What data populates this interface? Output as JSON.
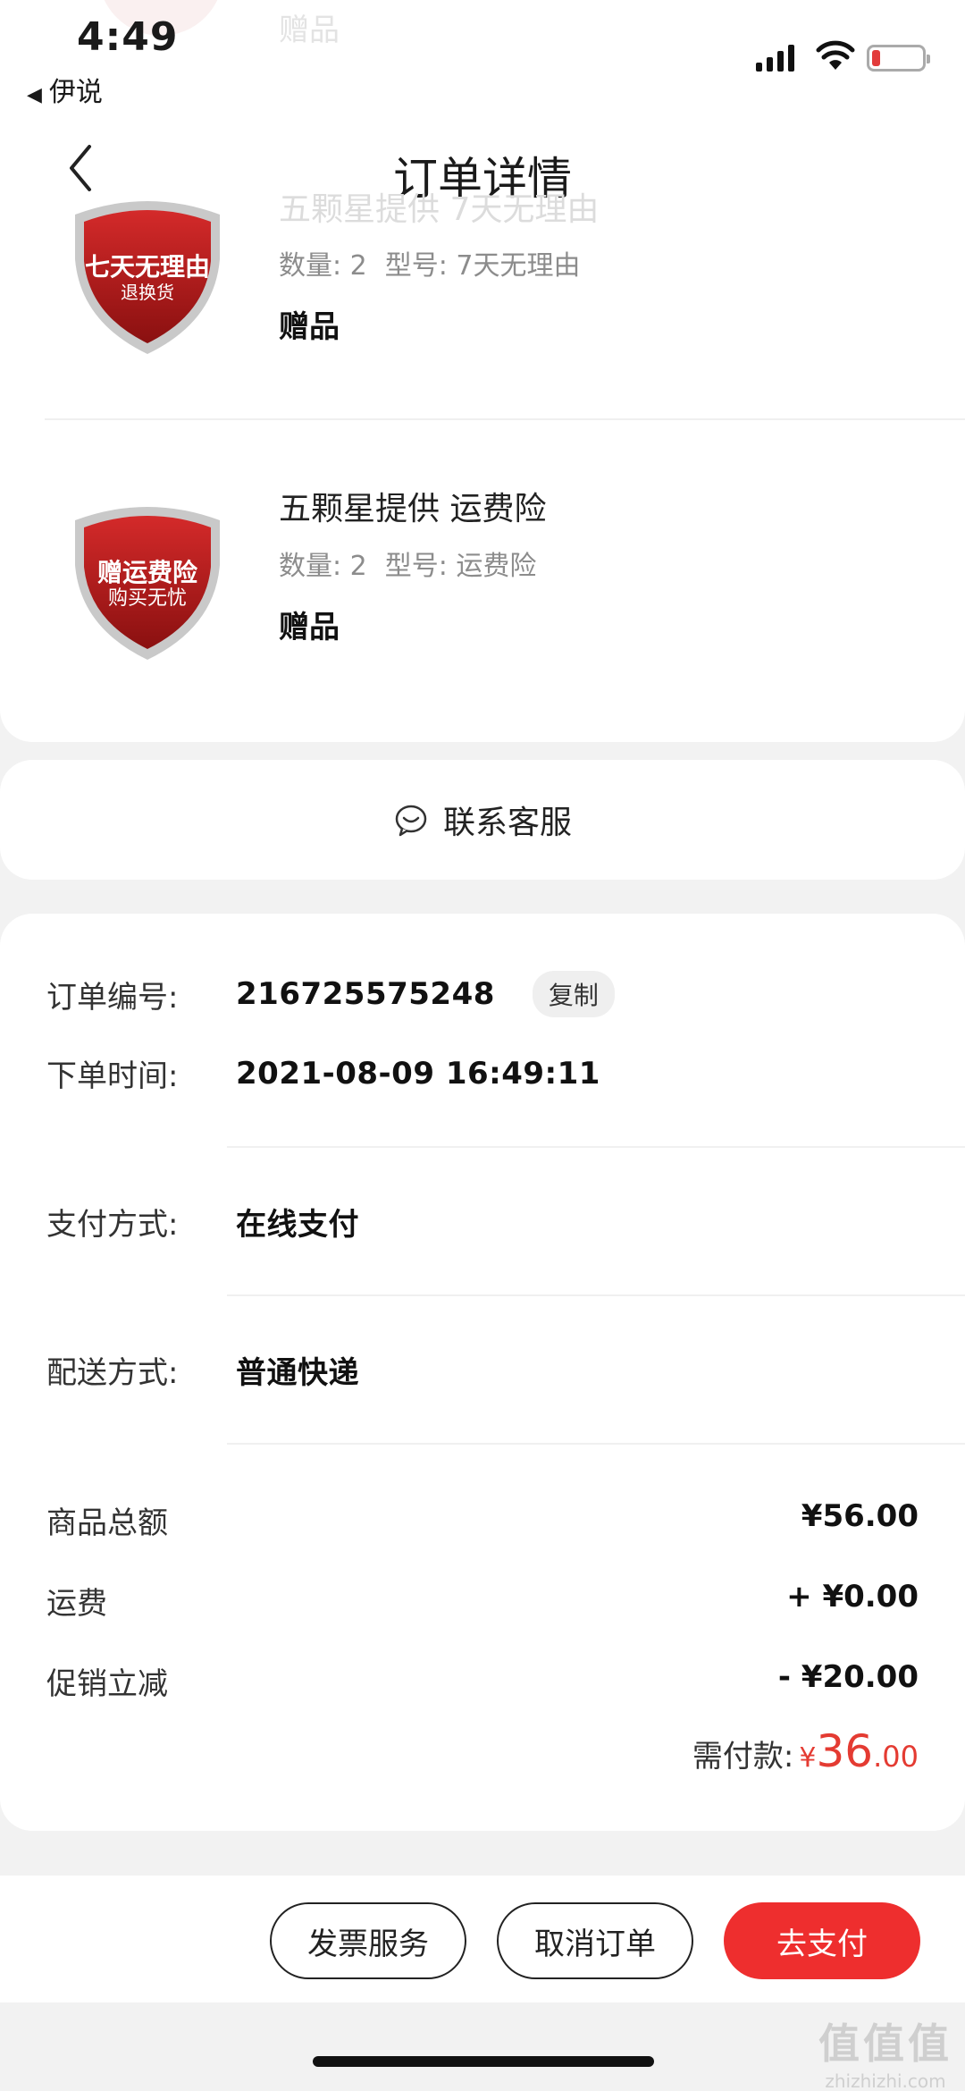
{
  "status_bar": {
    "time": "4:49",
    "back_app": "伊说"
  },
  "header": {
    "title": "订单详情"
  },
  "top_ghost_text": "赠品",
  "items": [
    {
      "name": "五颗星提供 7天无理由",
      "quantity": "数量: 2",
      "model": "型号: 7天无理由",
      "tag": "赠品",
      "badge_line1": "七天无理由",
      "badge_line2": "退换货"
    },
    {
      "name": "五颗星提供 运费险",
      "quantity": "数量: 2",
      "model": "型号: 运费险",
      "tag": "赠品",
      "badge_line1": "赠运费险",
      "badge_line2": "购买无忧"
    }
  ],
  "service": {
    "label": "联系客服"
  },
  "order_info": {
    "order_no_label": "订单编号:",
    "order_no": "216725575248",
    "copy_label": "复制",
    "order_time_label": "下单时间:",
    "order_time": "2021-08-09 16:49:11",
    "payment_label": "支付方式:",
    "payment": "在线支付",
    "delivery_label": "配送方式:",
    "delivery": "普通快递"
  },
  "amounts": {
    "goods_total_label": "商品总额",
    "goods_total": "¥56.00",
    "shipping_label": "运费",
    "shipping": "+ ¥0.00",
    "discount_label": "促销立减",
    "discount": "- ¥20.00",
    "payable_label": "需付款:",
    "payable_symbol": "¥",
    "payable_int": "36",
    "payable_dec": ".00"
  },
  "actions": {
    "invoice": "发票服务",
    "cancel": "取消订单",
    "pay": "去支付"
  },
  "watermark": {
    "line1": "值值值",
    "line2": "zhizhizhi.com"
  },
  "colors": {
    "accent": "#ee2e2e",
    "price": "#e43b32",
    "background": "#f2f2f2"
  }
}
